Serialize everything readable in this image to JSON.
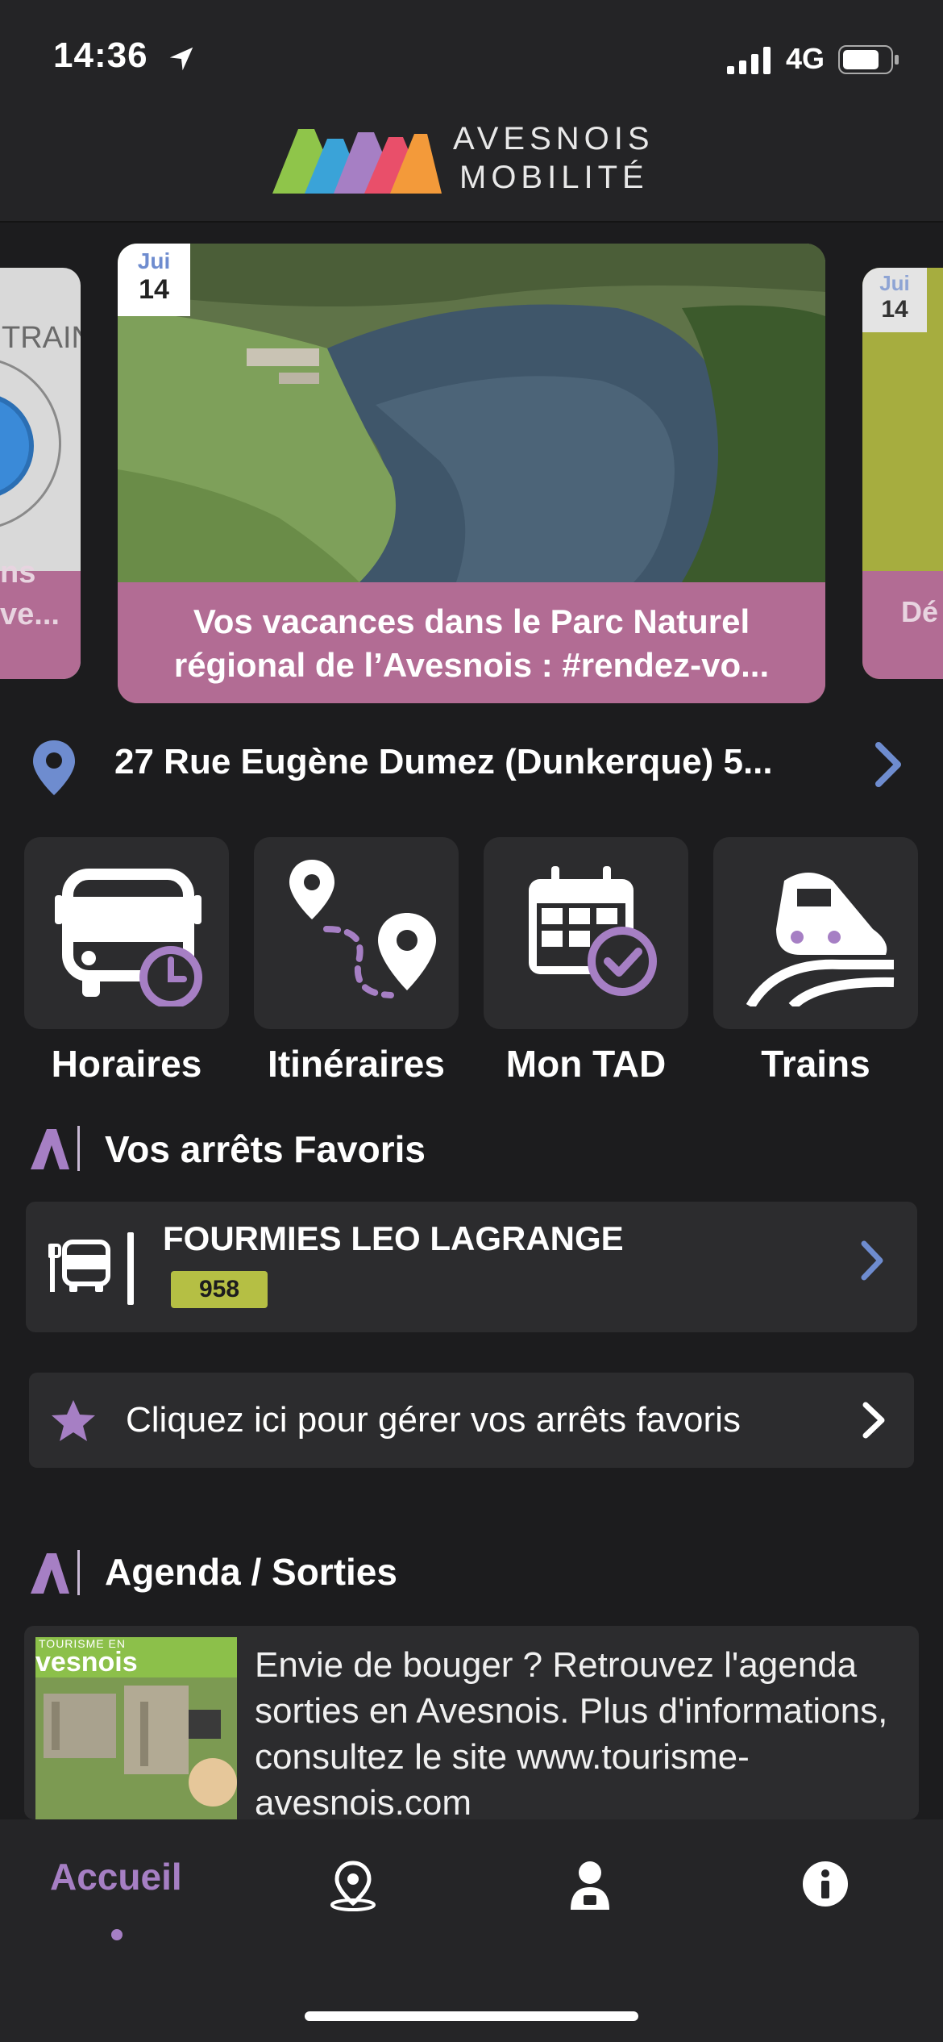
{
  "status_bar": {
    "time": "14:36",
    "network": "4G"
  },
  "header": {
    "brand_line1": "AVESNOIS",
    "brand_line2": "MOBILITÉ"
  },
  "carousel": {
    "left_card": {
      "label": "TRAIN",
      "caption_partial": "ns\nve..."
    },
    "main_card": {
      "month": "Jui",
      "day": "14",
      "title": "Vos vacances dans le Parc Naturel régional de l’Avesnois : #rendez-vo..."
    },
    "right_card": {
      "month": "Jui",
      "day": "14",
      "caption_partial": "Dé"
    }
  },
  "address": {
    "text": "27 Rue Eugène Dumez (Dunkerque) 5..."
  },
  "tiles": [
    {
      "label": "Horaires",
      "icon": "bus-clock-icon"
    },
    {
      "label": "Itinéraires",
      "icon": "route-pins-icon"
    },
    {
      "label": "Mon TAD",
      "icon": "calendar-check-icon"
    },
    {
      "label": "Trains",
      "icon": "train-icon"
    }
  ],
  "favorites": {
    "title": "Vos arrêts Favoris",
    "stop": {
      "name": "FOURMIES LEO LAGRANGE",
      "line": "958"
    },
    "manage_label": "Cliquez ici pour gérer vos arrêts favoris"
  },
  "agenda": {
    "title": "Agenda / Sorties",
    "thumb_small": "TOURISME EN",
    "thumb_big": "vesnois",
    "text": "Envie de bouger ? Retrouvez l'agenda sorties en Avesnois. Plus d'informations, consultez le site www.tourisme-avesnois.com"
  },
  "tabbar": {
    "active": "Accueil",
    "items": [
      "Accueil",
      "map-pin-icon",
      "account-icon",
      "info-icon"
    ]
  },
  "colors": {
    "accent": "#a67fc4",
    "card_caption": "#b26c94",
    "line_badge": "#b5bf44",
    "link_blue": "#6e8ccf"
  }
}
